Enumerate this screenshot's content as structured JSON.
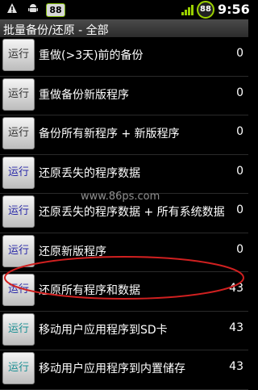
{
  "status_bar": {
    "battery_badge": "88",
    "battery_ring": "88",
    "time": "9:56",
    "icons": [
      "warning-icon",
      "android-icon",
      "signal-icon",
      "battery-ring-icon"
    ]
  },
  "title": "批量备份/还原 - 全部",
  "run_label": "运行",
  "rows": [
    {
      "label": "重做(>3天)前的备份",
      "count": "0",
      "button_color": "dark"
    },
    {
      "label": "重做备份新版程序",
      "count": "0",
      "button_color": "dark"
    },
    {
      "label": "备份所有新程序 + 新版程序",
      "count": "0",
      "button_color": "dark"
    },
    {
      "label": "还原丢失的程序数据",
      "count": "0",
      "button_color": "blue"
    },
    {
      "label": "还原丢失的程序数据 + 所有系统数据",
      "count": "0",
      "button_color": "blue"
    },
    {
      "label": "还原新版程序",
      "count": "0",
      "button_color": "blue"
    },
    {
      "label": "还原所有程序和数据",
      "count": "43",
      "button_color": "blue"
    },
    {
      "label": "移动用户应用程序到SD卡",
      "count": "43",
      "button_color": "teal"
    },
    {
      "label": "移动用户应用程序到内置储存",
      "count": "43",
      "button_color": "teal"
    }
  ],
  "watermark": "www.86ps.com",
  "colors": {
    "highlight": "#d02020",
    "accent": "#9ad000"
  }
}
